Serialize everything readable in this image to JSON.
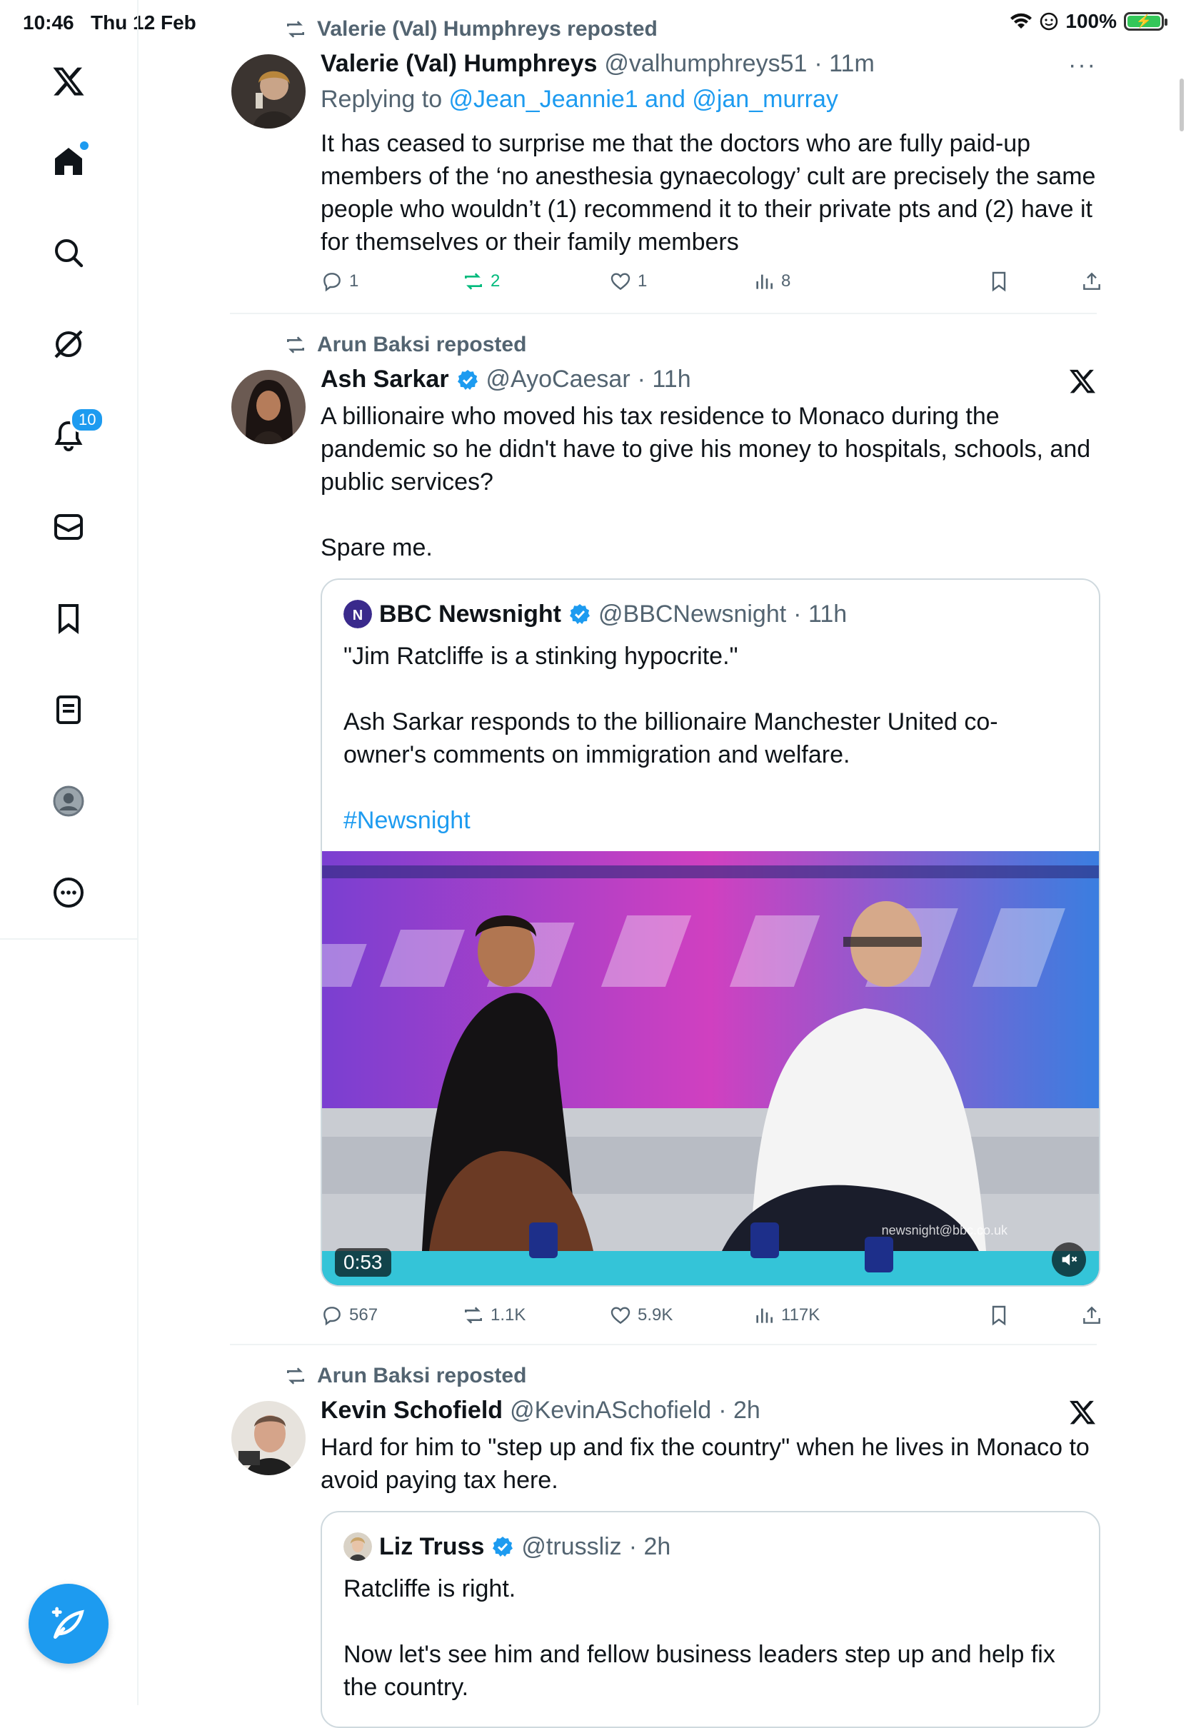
{
  "status_bar": {
    "time": "10:46",
    "date": "Thu 12 Feb",
    "battery": "100%"
  },
  "sidebar": {
    "notifications_badge": "10",
    "items": [
      "x-logo",
      "home",
      "search",
      "grok",
      "notifications",
      "messages",
      "bookmarks",
      "lists",
      "profile",
      "more"
    ]
  },
  "tweets": [
    {
      "repost_label": "Valerie (Val) Humphreys reposted",
      "name": "Valerie (Val) Humphreys",
      "handle": "@valhumphreys51",
      "time": "· 11m",
      "reply_prefix": "Replying to ",
      "reply_targets": "@Jean_Jeannie1 and @jan_murray",
      "body": "It has ceased to surprise me that the doctors who are fully paid-up members of the ‘no anesthesia gynaecology’ cult are precisely the same people who wouldn’t (1) recommend it to their private pts and (2) have it for themselves or their family members",
      "more": "···",
      "stats": {
        "replies": "1",
        "reposts": "2",
        "likes": "1",
        "views": "8"
      }
    },
    {
      "repost_label": "Arun Baksi reposted",
      "name": "Ash Sarkar",
      "handle": "@AyoCaesar",
      "time": "· 11h",
      "body": "A billionaire who moved his tax residence to Monaco during the pandemic so he didn't have to give his money to hospitals, schools, and public services?\n\nSpare me.",
      "quote": {
        "name": "BBC Newsnight",
        "handle": "@BBCNewsnight",
        "time": "· 11h",
        "body": "\"Jim Ratcliffe is a stinking hypocrite.\"\n\nAsh Sarkar responds to the billionaire Manchester United co-owner's comments on immigration and welfare.",
        "hashtag": "#Newsnight",
        "video_duration": "0:53",
        "watermark": "newsnight@bbc.co.uk"
      },
      "stats": {
        "replies": "567",
        "reposts": "1.1K",
        "likes": "5.9K",
        "views": "117K"
      }
    },
    {
      "repost_label": "Arun Baksi reposted",
      "name": "Kevin Schofield",
      "handle": "@KevinASchofield",
      "time": "· 2h",
      "body": "Hard for him to \"step up and fix the country\" when he lives in Monaco to avoid paying tax here.",
      "quote": {
        "name": "Liz Truss",
        "handle": "@trussliz",
        "time": "· 2h",
        "body": "Ratcliffe is right.\n\nNow let's see him and fellow business leaders step up and help fix the country."
      }
    }
  ],
  "colors": {
    "accent": "#1d9bf0",
    "repost_green": "#00ba7c",
    "muted": "#536471"
  }
}
